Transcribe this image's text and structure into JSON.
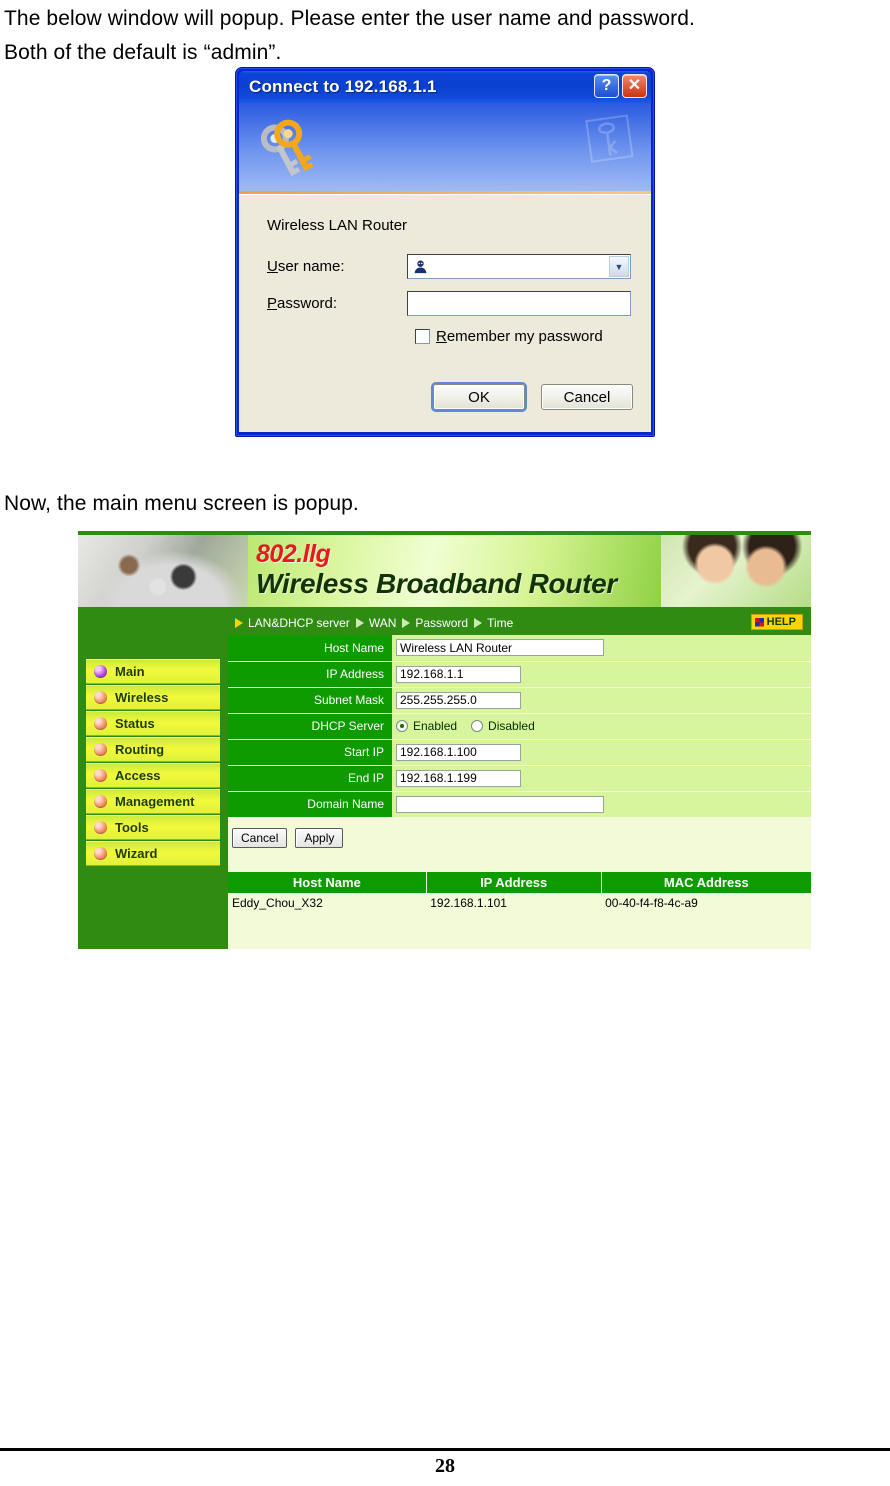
{
  "document": {
    "intro_line1": "The below window will popup.   Please enter the user name and password.",
    "intro_line2": "Both of the default is “admin”.",
    "mid_line": "Now, the main menu screen is popup.",
    "page_number": "28"
  },
  "connect_dialog": {
    "title": "Connect to 192.168.1.1",
    "help_button": "?",
    "close_button": "✕",
    "realm": "Wireless LAN Router",
    "username_label": "User name:",
    "username_value": "",
    "username_placeholder": "",
    "password_label": "Password:",
    "password_value": "",
    "password_placeholder": "",
    "remember_label": "Remember my password",
    "remember_checked": false,
    "ok_label": "OK",
    "cancel_label": "Cancel",
    "icons": {
      "keys": "keys-icon",
      "user": "user-icon",
      "dropdown": "chevron-down-icon"
    },
    "colors": {
      "titlebar": "#0A44D8",
      "body": "#EDE9DB",
      "accent": "#E8A24A"
    }
  },
  "router_ui": {
    "banner": {
      "brand_small": "802.llg",
      "brand_large": "Wireless  Broadband  Router",
      "brand_small_color": "#E8191B",
      "brand_large_color": "#123305"
    },
    "nav": {
      "items": [
        {
          "label": "LAN&DHCP server",
          "active": true
        },
        {
          "label": "WAN",
          "active": false
        },
        {
          "label": "Password",
          "active": false
        },
        {
          "label": "Time",
          "active": false
        }
      ],
      "help_label": "HELP"
    },
    "sidebar": {
      "items": [
        {
          "label": "Main",
          "active": true
        },
        {
          "label": "Wireless",
          "active": false
        },
        {
          "label": "Status",
          "active": false
        },
        {
          "label": "Routing",
          "active": false
        },
        {
          "label": "Access",
          "active": false
        },
        {
          "label": "Management",
          "active": false
        },
        {
          "label": "Tools",
          "active": false
        },
        {
          "label": "Wizard",
          "active": false
        }
      ]
    },
    "form": {
      "host_name_label": "Host Name",
      "host_name_value": "Wireless LAN Router",
      "ip_address_label": "IP Address",
      "ip_address_value": "192.168.1.1",
      "subnet_mask_label": "Subnet Mask",
      "subnet_mask_value": "255.255.255.0",
      "dhcp_server_label": "DHCP Server",
      "dhcp_enabled_label": "Enabled",
      "dhcp_disabled_label": "Disabled",
      "dhcp_selected": "Enabled",
      "start_ip_label": "Start IP",
      "start_ip_value": "192.168.1.100",
      "end_ip_label": "End IP",
      "end_ip_value": "192.168.1.199",
      "domain_name_label": "Domain Name",
      "domain_name_value": "",
      "cancel_label": "Cancel",
      "apply_label": "Apply"
    },
    "client_table": {
      "headers": [
        "Host Name",
        "IP Address",
        "MAC Address"
      ],
      "rows": [
        [
          "Eddy_Chou_X32",
          "192.168.1.101",
          "00-40-f4-f8-4c-a9"
        ]
      ]
    },
    "colors": {
      "green_dark": "#2F8B12",
      "green_label": "#0E9B00",
      "green_light": "#D6F59C",
      "green_pale": "#F2FAD8",
      "menu_yellow": "#F3F93C"
    }
  }
}
